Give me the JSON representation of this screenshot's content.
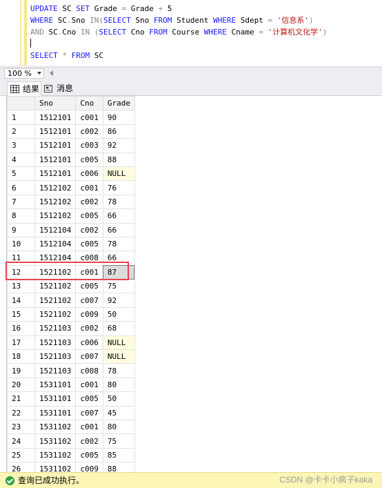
{
  "editor": {
    "lines": [
      [
        {
          "t": "UPDATE",
          "c": "kw"
        },
        {
          "t": " SC ",
          "c": ""
        },
        {
          "t": "SET",
          "c": "kw"
        },
        {
          "t": " Grade ",
          "c": ""
        },
        {
          "t": "=",
          "c": "gr"
        },
        {
          "t": " Grade ",
          "c": ""
        },
        {
          "t": "+",
          "c": "gr"
        },
        {
          "t": " 5",
          "c": ""
        }
      ],
      [
        {
          "t": "WHERE",
          "c": "kw"
        },
        {
          "t": " SC",
          "c": ""
        },
        {
          "t": ".",
          "c": "gr"
        },
        {
          "t": "Sno ",
          "c": ""
        },
        {
          "t": "IN(",
          "c": "gr"
        },
        {
          "t": "SELECT",
          "c": "kw"
        },
        {
          "t": " Sno ",
          "c": ""
        },
        {
          "t": "FROM",
          "c": "kw"
        },
        {
          "t": " Student ",
          "c": ""
        },
        {
          "t": "WHERE",
          "c": "kw"
        },
        {
          "t": " Sdept ",
          "c": ""
        },
        {
          "t": "=",
          "c": "gr"
        },
        {
          "t": " '信息系'",
          "c": "str"
        },
        {
          "t": ")",
          "c": "gr"
        }
      ],
      [
        {
          "t": "AND",
          "c": "gr"
        },
        {
          "t": " SC",
          "c": ""
        },
        {
          "t": ".",
          "c": "gr"
        },
        {
          "t": "Cno ",
          "c": ""
        },
        {
          "t": "IN",
          "c": "gr"
        },
        {
          "t": " (",
          "c": "gr"
        },
        {
          "t": "SELECT",
          "c": "kw"
        },
        {
          "t": " Cno ",
          "c": ""
        },
        {
          "t": "FROM",
          "c": "kw"
        },
        {
          "t": " Course ",
          "c": ""
        },
        {
          "t": "WHERE",
          "c": "kw"
        },
        {
          "t": " Cname ",
          "c": ""
        },
        {
          "t": "=",
          "c": "gr"
        },
        {
          "t": " '计算机文化学'",
          "c": "str"
        },
        {
          "t": ")",
          "c": "gr"
        }
      ],
      [],
      [
        {
          "t": "SELECT",
          "c": "kw"
        },
        {
          "t": " ",
          "c": ""
        },
        {
          "t": "*",
          "c": "gr"
        },
        {
          "t": " ",
          "c": ""
        },
        {
          "t": "FROM",
          "c": "kw"
        },
        {
          "t": " SC",
          "c": ""
        }
      ]
    ]
  },
  "zoom": {
    "value": "100 %"
  },
  "tabs": {
    "results": "结果",
    "messages": "消息"
  },
  "grid": {
    "columns": [
      "Sno",
      "Cno",
      "Grade"
    ],
    "highlighted_row": "12",
    "rows": [
      [
        "1",
        "1512101",
        "c001",
        "90"
      ],
      [
        "2",
        "1512101",
        "c002",
        "86"
      ],
      [
        "3",
        "1512101",
        "c003",
        "92"
      ],
      [
        "4",
        "1512101",
        "c005",
        "88"
      ],
      [
        "5",
        "1512101",
        "c006",
        "NULL"
      ],
      [
        "6",
        "1512102",
        "c001",
        "76"
      ],
      [
        "7",
        "1512102",
        "c002",
        "78"
      ],
      [
        "8",
        "1512102",
        "c005",
        "66"
      ],
      [
        "9",
        "1512104",
        "c002",
        "66"
      ],
      [
        "10",
        "1512104",
        "c005",
        "78"
      ],
      [
        "11",
        "1512104",
        "c008",
        "66"
      ],
      [
        "12",
        "1521102",
        "c001",
        "87"
      ],
      [
        "13",
        "1521102",
        "c005",
        "75"
      ],
      [
        "14",
        "1521102",
        "c007",
        "92"
      ],
      [
        "15",
        "1521102",
        "c009",
        "50"
      ],
      [
        "16",
        "1521103",
        "c002",
        "68"
      ],
      [
        "17",
        "1521103",
        "c006",
        "NULL"
      ],
      [
        "18",
        "1521103",
        "c007",
        "NULL"
      ],
      [
        "19",
        "1521103",
        "c008",
        "78"
      ],
      [
        "20",
        "1531101",
        "c001",
        "80"
      ],
      [
        "21",
        "1531101",
        "c005",
        "50"
      ],
      [
        "22",
        "1531101",
        "c007",
        "45"
      ],
      [
        "23",
        "1531102",
        "c001",
        "80"
      ],
      [
        "24",
        "1531102",
        "c002",
        "75"
      ],
      [
        "25",
        "1531102",
        "c005",
        "85"
      ],
      [
        "26",
        "1531102",
        "c009",
        "88"
      ]
    ]
  },
  "status": {
    "text": "查询已成功执行。"
  },
  "watermark": "CSDN @卡卡小疯子kaka",
  "colors": {
    "keyword": "#1a1aff",
    "string": "#c21818",
    "highlight_border": "#e8424e",
    "status_bg": "#fbf6b6",
    "null_bg": "#fffde0"
  }
}
